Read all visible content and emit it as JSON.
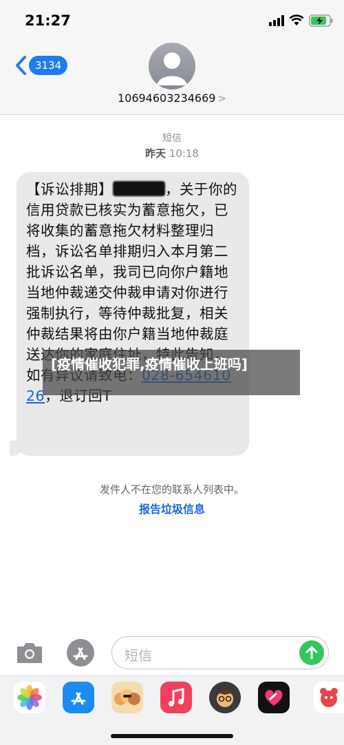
{
  "status_bar": {
    "time": "21:27"
  },
  "nav": {
    "back_count": "3134",
    "contact_number": "10694603234669",
    "contact_chevron": ">"
  },
  "thread": {
    "message_type": "短信",
    "date_label": "昨天",
    "time_label": "10:18"
  },
  "message": {
    "part1": "【诉讼排期】",
    "part2": "，关于你的信用贷款已核实为蓄意拖欠，已将收集的蓄意拖欠材料整理归档，诉讼名单排期归入本月第二批诉讼名单，我司已向你户籍地当地仲裁递交仲裁申请对你进行强制执行，等待仲裁批复，相关仲裁结果将由你户籍当地仲裁庭送达你的家庭住址，特此告知，如有异议请致电：",
    "phone": "028-65461026",
    "part3": "，退订回T"
  },
  "overlay": {
    "headline": "[疫情催收犯罪,疫情催收上班吗]"
  },
  "notice": {
    "text": "发件人不在您的联系人列表中。",
    "report_link": "报告垃圾信息"
  },
  "composer": {
    "placeholder": "短信"
  },
  "app_tray": [
    "photos-app",
    "app-store",
    "memoji-stickers",
    "music-app",
    "memoji",
    "digital-touch",
    "game-app"
  ],
  "colors": {
    "accent": "#1e7cf5",
    "bubble": "#e9e9eb",
    "send": "#34c759",
    "link": "#1a66d8"
  }
}
